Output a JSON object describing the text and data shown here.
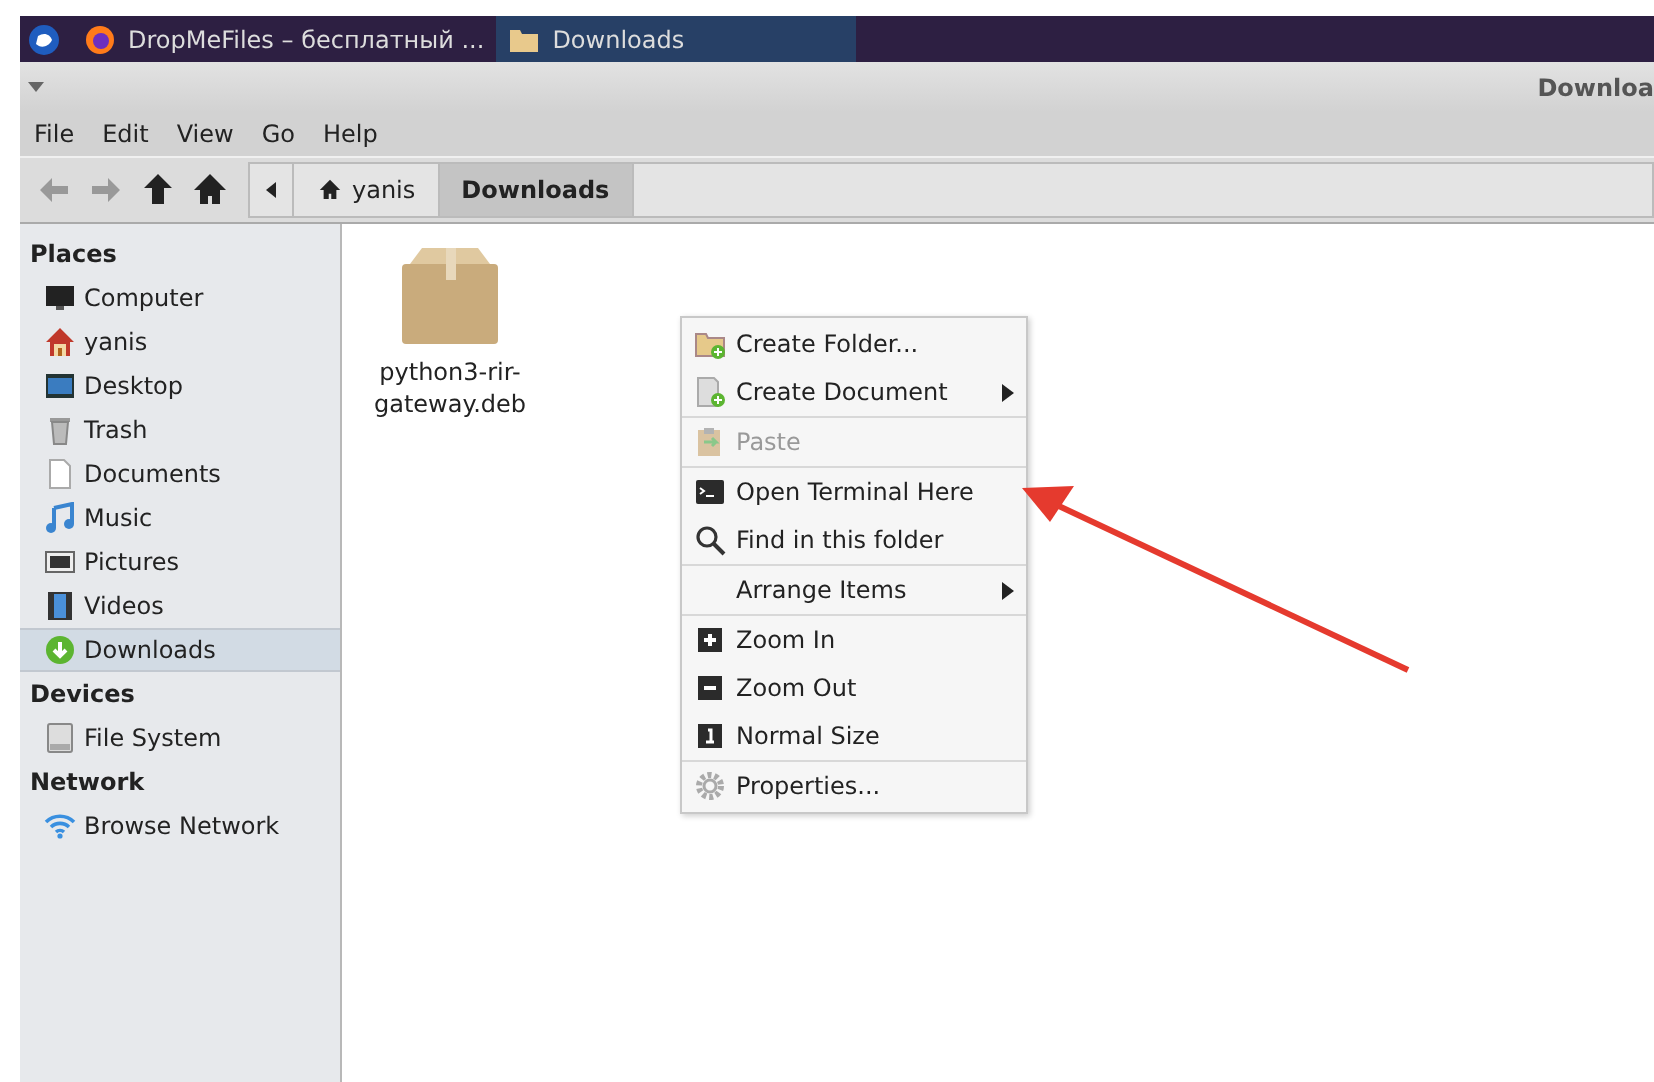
{
  "taskbar": {
    "tasks": [
      {
        "label": "DropMeFiles – бесплатный ...",
        "selected": false
      },
      {
        "label": "Downloads",
        "selected": true
      }
    ]
  },
  "window": {
    "title": "Downloa"
  },
  "menubar": [
    "File",
    "Edit",
    "View",
    "Go",
    "Help"
  ],
  "toolbar": {
    "back_disabled": true,
    "forward_disabled": true
  },
  "breadcrumb": [
    {
      "label": "yanis",
      "selected": false
    },
    {
      "label": "Downloads",
      "selected": true
    }
  ],
  "sidebar": {
    "sections": [
      {
        "title": "Places",
        "items": [
          {
            "label": "Computer",
            "selected": false
          },
          {
            "label": "yanis",
            "selected": false
          },
          {
            "label": "Desktop",
            "selected": false
          },
          {
            "label": "Trash",
            "selected": false
          },
          {
            "label": "Documents",
            "selected": false
          },
          {
            "label": "Music",
            "selected": false
          },
          {
            "label": "Pictures",
            "selected": false
          },
          {
            "label": "Videos",
            "selected": false
          },
          {
            "label": "Downloads",
            "selected": true
          }
        ]
      },
      {
        "title": "Devices",
        "items": [
          {
            "label": "File System",
            "selected": false
          }
        ]
      },
      {
        "title": "Network",
        "items": [
          {
            "label": "Browse Network",
            "selected": false
          }
        ]
      }
    ]
  },
  "files": [
    {
      "name": "python3-rir-gateway.deb"
    }
  ],
  "context_menu": {
    "groups": [
      [
        {
          "label": "Create Folder...",
          "kind": "item",
          "disabled": false
        },
        {
          "label": "Create Document",
          "kind": "submenu",
          "disabled": false
        }
      ],
      [
        {
          "label": "Paste",
          "kind": "item",
          "disabled": true
        }
      ],
      [
        {
          "label": "Open Terminal Here",
          "kind": "item",
          "disabled": false
        },
        {
          "label": "Find in this folder",
          "kind": "item",
          "disabled": false
        }
      ],
      [
        {
          "label": "Arrange Items",
          "kind": "submenu",
          "disabled": false
        }
      ],
      [
        {
          "label": "Zoom In",
          "kind": "item",
          "disabled": false
        },
        {
          "label": "Zoom Out",
          "kind": "item",
          "disabled": false
        },
        {
          "label": "Normal Size",
          "kind": "item",
          "disabled": false
        }
      ],
      [
        {
          "label": "Properties...",
          "kind": "item",
          "disabled": false
        }
      ]
    ]
  }
}
